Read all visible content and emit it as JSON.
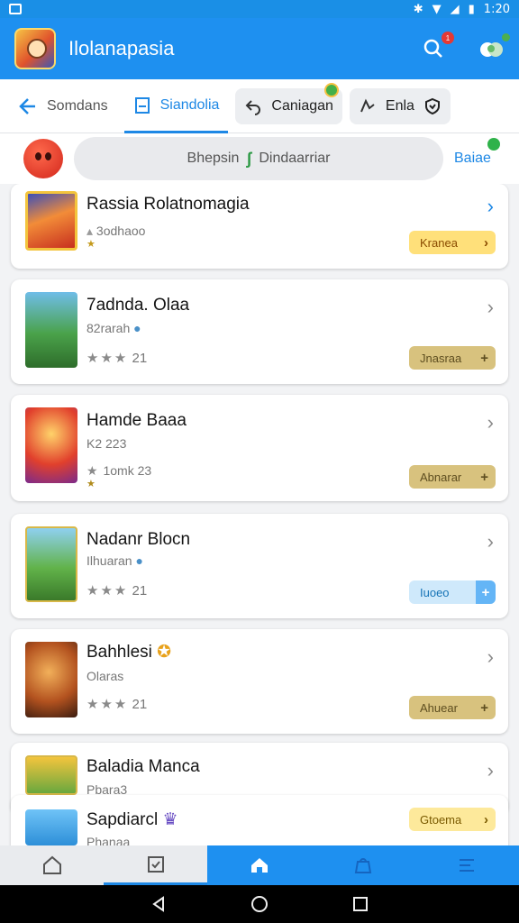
{
  "status_bar": {
    "time": "1:20",
    "icons": [
      "bluetooth-icon",
      "wifi-icon",
      "signal-icon",
      "battery-icon"
    ]
  },
  "app_bar": {
    "title": "Ilolanapasia",
    "icons": [
      "search-icon",
      "notification-icon"
    ],
    "search_badge": "1"
  },
  "tabs": [
    {
      "label": "Somdans",
      "icon": "back-arrow-icon",
      "state": "normal"
    },
    {
      "label": "Siandolia",
      "icon": "document-icon",
      "state": "active"
    },
    {
      "label": "Caniagan",
      "icon": "undo-icon",
      "state": "pill"
    },
    {
      "label": "Enla",
      "icon": "filter-icon",
      "state": "pill"
    }
  ],
  "search": {
    "text_left": "Bhepsin",
    "text_right": "Dindaarriar",
    "action": "Baiae"
  },
  "apps": [
    {
      "title": "Rassia Rolatnomagia",
      "sub": "3odhaoo",
      "button": "Kranea",
      "button_style": "yellow",
      "chevron": "blue",
      "rating": ""
    },
    {
      "title": "7adnda. Olaa",
      "sub": "82rarah",
      "rating": "21",
      "button": "Jnasraa",
      "button_style": "khaki"
    },
    {
      "title": "Hamde Baaa",
      "sub": "K2 223",
      "rating": "1omk 23",
      "button": "Abnarar",
      "button_style": "khaki"
    },
    {
      "title": "Nadanr Blocn",
      "sub": "Ilhuaran",
      "rating": "21",
      "button": "Iuoeo",
      "button_style": "lightblue"
    },
    {
      "title": "Bahhlesi",
      "sub": "Olaras",
      "rating": "21",
      "button": "Ahuear",
      "button_style": "khaki"
    },
    {
      "title": "Baladia Manca",
      "sub": "Pbara3",
      "rating": "",
      "button": "",
      "button_style": ""
    },
    {
      "title": "Sapdiarcl",
      "sub": "Phanaa",
      "rating": "",
      "button": "Gtoema",
      "button_style": "lightyellow"
    }
  ],
  "bottom_nav": [
    "home-icon",
    "tasks-icon",
    "house-icon",
    "bag-icon",
    "list-icon"
  ],
  "system_nav": [
    "back",
    "home",
    "recents"
  ]
}
